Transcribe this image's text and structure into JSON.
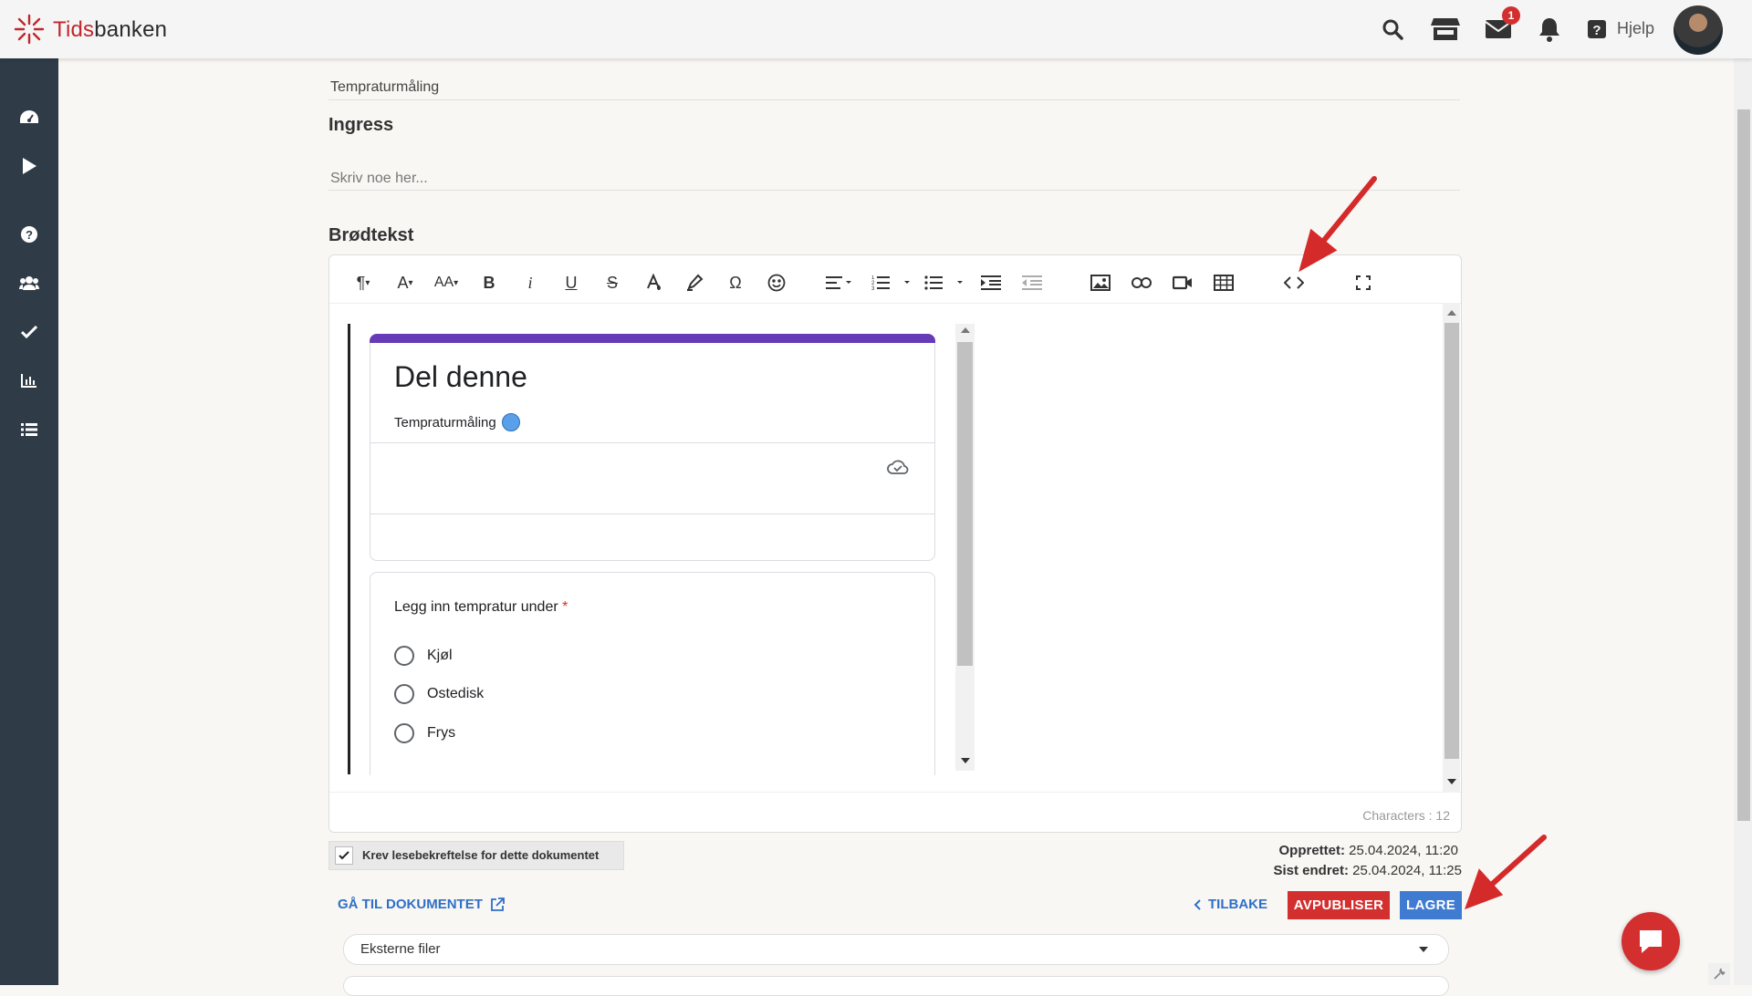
{
  "app": {
    "logo_part1": "Tids",
    "logo_part2": "banken"
  },
  "topbar": {
    "help_label": "Hjelp",
    "mail_badge": "1"
  },
  "sidebar": {
    "items": [
      "dashboard-icon",
      "play-icon",
      "help-icon",
      "users-icon",
      "check-icon",
      "chart-icon",
      "list-icon"
    ]
  },
  "document": {
    "title_value": "Tempraturmåling",
    "ingress_heading": "Ingress",
    "ingress_placeholder": "Skriv noe her...",
    "body_heading": "Brødtekst",
    "characters_label": "Characters : 12"
  },
  "embedded_form": {
    "title": "Del denne",
    "subtitle": "Tempraturmåling",
    "question": "Legg inn tempratur under",
    "required_mark": "*",
    "options": [
      "Kjøl",
      "Ostedisk",
      "Frys"
    ]
  },
  "bottom": {
    "read_confirm_label": "Krev lesebekreftelse for dette dokumentet",
    "created_label": "Opprettet:",
    "created_value": "25.04.2024, 11:20",
    "modified_label": "Sist endret:",
    "modified_value": "25.04.2024, 11:25",
    "goto_label": "GÅ TIL DOKUMENTET",
    "back_label": "TILBAKE",
    "unpublish_label": "AVPUBLISER",
    "save_label": "LAGRE",
    "external_files_label": "Eksterne filer"
  },
  "colors": {
    "brand_red": "#c0272d",
    "sidebar": "#2f3b47",
    "unpublish": "#d32f2f",
    "save": "#3f7bd0",
    "link": "#2f6fc7",
    "form_accent": "#673ab7"
  }
}
